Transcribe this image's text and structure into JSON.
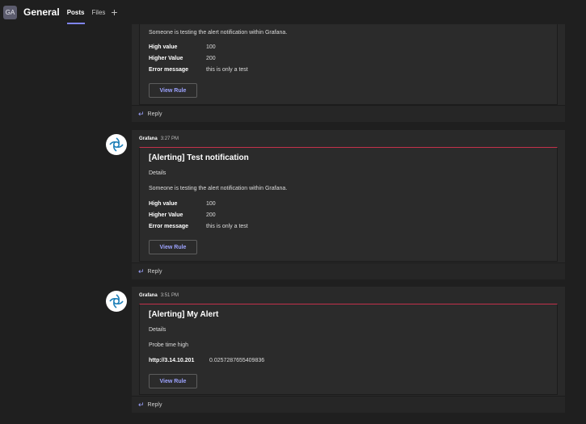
{
  "header": {
    "team_initials": "GA",
    "channel_name": "General",
    "tabs": [
      {
        "label": "Posts",
        "active": true
      },
      {
        "label": "Files",
        "active": false
      }
    ],
    "add_tab_glyph": "+"
  },
  "threads": [
    {
      "card": {
        "intro": "Someone is testing the alert notification within Grafana.",
        "fields": [
          {
            "key": "High value",
            "value": "100"
          },
          {
            "key": "Higher Value",
            "value": "200"
          },
          {
            "key": "Error message",
            "value": "this is only a test"
          }
        ],
        "button_label": "View Rule"
      },
      "reply_label": "Reply"
    },
    {
      "author": "Grafana",
      "time": "3:27 PM",
      "card": {
        "title": "[Alerting] Test notification",
        "details_label": "Details",
        "intro": "Someone is testing the alert notification within Grafana.",
        "fields": [
          {
            "key": "High value",
            "value": "100"
          },
          {
            "key": "Higher Value",
            "value": "200"
          },
          {
            "key": "Error message",
            "value": "this is only a test"
          }
        ],
        "button_label": "View Rule"
      },
      "reply_label": "Reply"
    },
    {
      "author": "Grafana",
      "time": "3:51 PM",
      "card": {
        "title": "[Alerting] My Alert",
        "details_label": "Details",
        "intro": "Probe time high",
        "fields": [
          {
            "key": "http://3.14.10.201",
            "value": "0.0257287655409836"
          }
        ],
        "button_label": "View Rule"
      },
      "reply_label": "Reply"
    }
  ],
  "colors": {
    "background": "#1f1f1f",
    "panel": "#292929",
    "accent": "#7f85f5",
    "link": "#9da3ff",
    "alert_red": "#c4314b"
  },
  "icons": {
    "bot_avatar": "grafana-logo-icon",
    "reply": "reply-arrow-icon",
    "add_tab": "plus-icon"
  }
}
